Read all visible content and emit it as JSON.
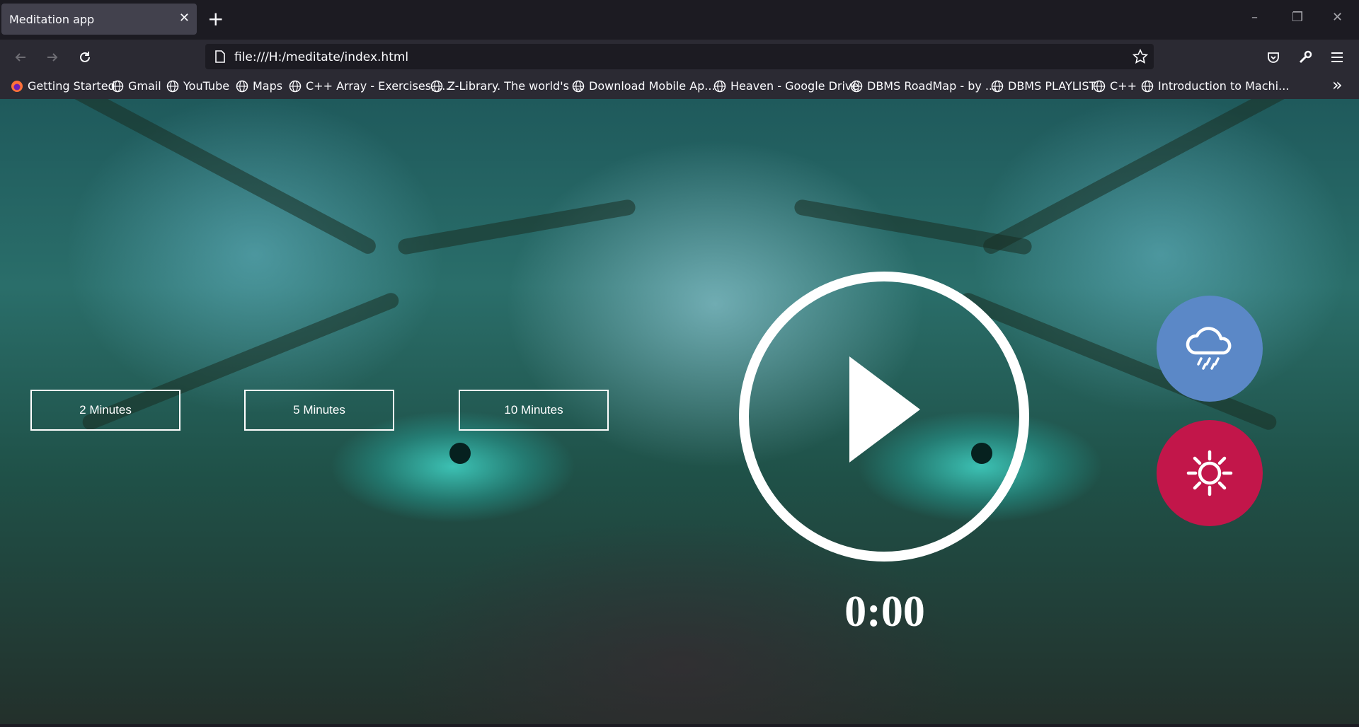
{
  "browser": {
    "tab_title": "Meditation app",
    "tab_close": "✕",
    "new_tab": "+",
    "url": "file:///H:/meditate/index.html",
    "window_controls": {
      "minimize": "–",
      "restore": "❐",
      "close": "✕"
    },
    "overflow": "»"
  },
  "bookmarks": [
    {
      "label": "Getting Started",
      "icon": "firefox-icon"
    },
    {
      "label": "Gmail",
      "icon": "globe-icon"
    },
    {
      "label": "YouTube",
      "icon": "globe-icon"
    },
    {
      "label": "Maps",
      "icon": "globe-icon"
    },
    {
      "label": "C++ Array - Exercises, ...",
      "icon": "globe-icon"
    },
    {
      "label": "Z-Library. The world's ...",
      "icon": "globe-icon"
    },
    {
      "label": "Download Mobile Ap...",
      "icon": "globe-icon"
    },
    {
      "label": "Heaven - Google Drive",
      "icon": "globe-icon"
    },
    {
      "label": "DBMS RoadMap - by ...",
      "icon": "globe-icon"
    },
    {
      "label": "DBMS PLAYLIST",
      "icon": "globe-icon"
    },
    {
      "label": "C++",
      "icon": "globe-icon"
    },
    {
      "label": "Introduction to Machi...",
      "icon": "globe-icon"
    }
  ],
  "app": {
    "durations": [
      "2 Minutes",
      "5 Minutes",
      "10 Minutes"
    ],
    "timer": "0:00",
    "sound_buttons": [
      {
        "icon": "rain-cloud-icon",
        "color": "#5b88c7"
      },
      {
        "icon": "sun-icon",
        "color": "#c2164a"
      }
    ]
  }
}
